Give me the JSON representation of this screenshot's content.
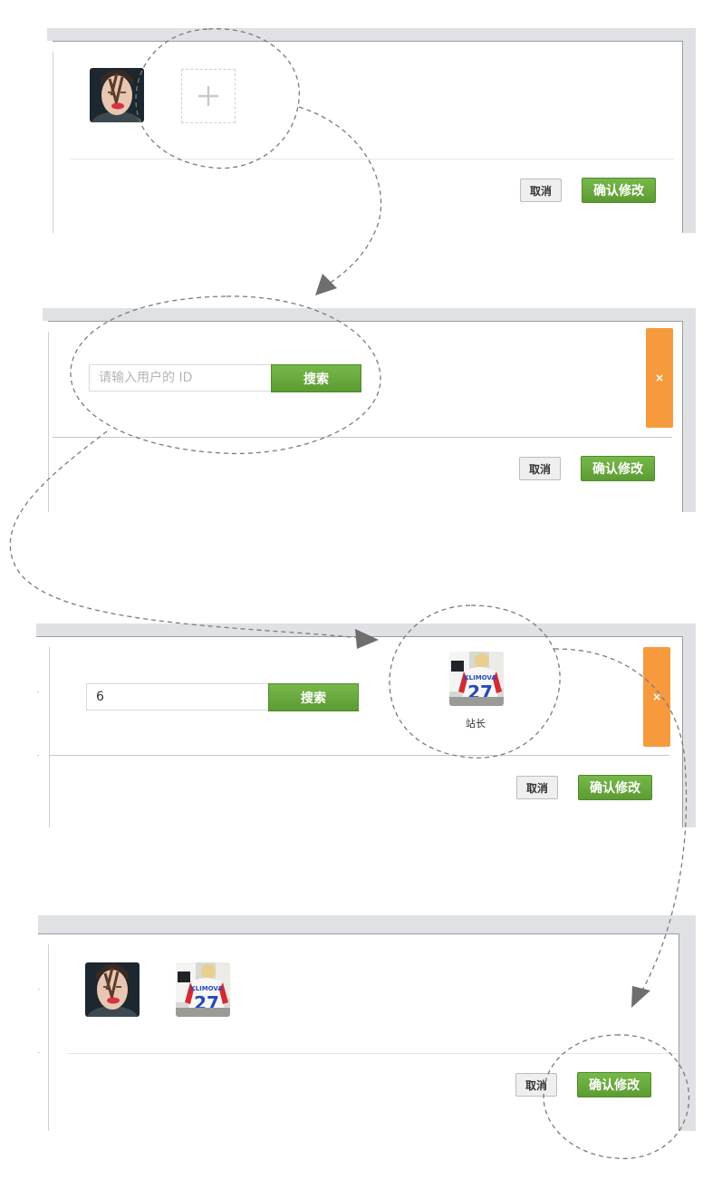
{
  "step1": {
    "cancel_label": "取消",
    "confirm_label": "确认修改",
    "avatars": [
      "avatar-woman"
    ],
    "add_icon": "plus-icon"
  },
  "step2": {
    "search_placeholder": "请输入用户的 ID",
    "search_label": "搜索",
    "close_label": "×",
    "cancel_label": "取消",
    "confirm_label": "确认修改"
  },
  "step3": {
    "search_value": "6",
    "search_label": "搜索",
    "result_name": "站长",
    "close_label": "×",
    "cancel_label": "取消",
    "confirm_label": "确认修改"
  },
  "step4": {
    "avatars": [
      "avatar-woman",
      "avatar-jersey"
    ],
    "cancel_label": "取消",
    "confirm_label": "确认修改"
  },
  "colors": {
    "accent_green": "#62a33a",
    "close_orange": "#f79a3e",
    "frame_gray": "#dfe1e5"
  }
}
